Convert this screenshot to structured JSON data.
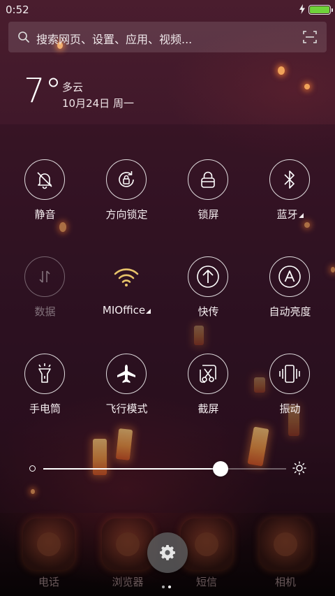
{
  "status_bar": {
    "time": "0:52",
    "battery_level": 1.0,
    "charging": true,
    "battery_color": "#6fd23a"
  },
  "search": {
    "placeholder": "搜索网页、设置、应用、视频...",
    "left_icon": "search-icon",
    "right_icon": "scan-icon"
  },
  "weather": {
    "temperature": "7°",
    "condition": "多云",
    "date": "10月24日 周一"
  },
  "toggles": [
    {
      "id": "mute",
      "label": "静音",
      "icon": "bell-off-icon",
      "state": "on"
    },
    {
      "id": "rotation-lock",
      "label": "方向锁定",
      "icon": "rotation-lock-icon",
      "state": "on"
    },
    {
      "id": "lock-screen",
      "label": "锁屏",
      "icon": "lock-icon",
      "state": "on"
    },
    {
      "id": "bluetooth",
      "label": "蓝牙",
      "icon": "bluetooth-icon",
      "state": "on",
      "has_menu": true
    },
    {
      "id": "data",
      "label": "数据",
      "icon": "data-arrows-icon",
      "state": "off"
    },
    {
      "id": "wifi",
      "label": "MIOffice",
      "icon": "wifi-icon",
      "state": "active",
      "has_menu": true,
      "accent": "#e8c46a"
    },
    {
      "id": "quick-transfer",
      "label": "快传",
      "icon": "upload-arrow-icon",
      "state": "on"
    },
    {
      "id": "auto-brightness",
      "label": "自动亮度",
      "icon": "auto-brightness-icon",
      "state": "on"
    },
    {
      "id": "flashlight",
      "label": "手电筒",
      "icon": "flashlight-icon",
      "state": "on"
    },
    {
      "id": "airplane",
      "label": "飞行模式",
      "icon": "airplane-icon",
      "state": "on"
    },
    {
      "id": "screenshot",
      "label": "截屏",
      "icon": "scissors-icon",
      "state": "on"
    },
    {
      "id": "vibrate",
      "label": "振动",
      "icon": "vibrate-icon",
      "state": "on"
    }
  ],
  "brightness": {
    "level": 0.73,
    "low_icon": "brightness-low-icon",
    "high_icon": "brightness-high-icon"
  },
  "dock": {
    "apps": [
      {
        "label": "电话",
        "icon": "phone-icon"
      },
      {
        "label": "浏览器",
        "icon": "browser-icon"
      },
      {
        "label": "短信",
        "icon": "message-icon"
      },
      {
        "label": "相机",
        "icon": "camera-icon"
      }
    ],
    "settings_icon": "gear-icon",
    "page_indicator": {
      "count": 2,
      "active": 1
    }
  }
}
